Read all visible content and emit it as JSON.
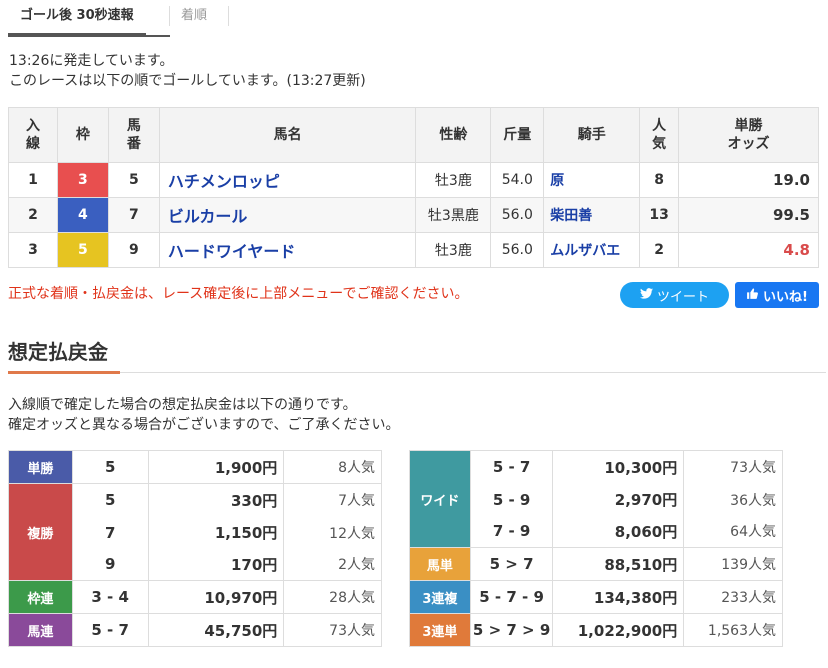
{
  "tabs": {
    "active": "ゴール後 30秒速報",
    "inactive": "着順"
  },
  "status": {
    "line1": "13:26に発走しています。",
    "line2": "このレースは以下の順でゴールしています。(13:27更新)"
  },
  "result_table": {
    "headers": {
      "rank": "入\n線",
      "waku": "枠",
      "umaban": "馬\n番",
      "name": "馬名",
      "sexage": "性齢",
      "weight": "斤量",
      "jockey": "騎手",
      "popularity": "人\n気",
      "odds": "単勝\nオッズ"
    },
    "rows": [
      {
        "rank": "1",
        "waku": "3",
        "waku_color": "#e84f4f",
        "umaban": "5",
        "name": "ハチメンロッピ",
        "sexage": "牡3鹿",
        "weight": "54.0",
        "jockey": "原",
        "popularity": "8",
        "odds": "19.0",
        "odds_color": "#333333"
      },
      {
        "rank": "2",
        "waku": "4",
        "waku_color": "#3a5fc0",
        "umaban": "7",
        "name": "ビルカール",
        "sexage": "牡3黒鹿",
        "weight": "56.0",
        "jockey": "柴田善",
        "popularity": "13",
        "odds": "99.5",
        "odds_color": "#333333"
      },
      {
        "rank": "3",
        "waku": "5",
        "waku_color": "#e6c421",
        "umaban": "9",
        "name": "ハードワイヤード",
        "sexage": "牡3鹿",
        "weight": "56.0",
        "jockey": "ムルザバエ",
        "popularity": "2",
        "odds": "4.8",
        "odds_color": "#d94b4b"
      }
    ]
  },
  "notice": "正式な着順・払戻金は、レース確定後に上部メニューでご確認ください。",
  "share": {
    "tweet": "ツイート",
    "like": "いいね!"
  },
  "section_title": "想定払戻金",
  "desc": {
    "line1": "入線順で確定した場合の想定払戻金は以下の通りです。",
    "line2": "確定オッズと異なる場合がございますので、ご了承ください。"
  },
  "payout_left": [
    {
      "type": "単勝",
      "color": "#4a5ba8",
      "rows": [
        {
          "combo": "5",
          "amount": "1,900円",
          "pop": "8人気"
        }
      ]
    },
    {
      "type": "複勝",
      "color": "#c94a4a",
      "rows": [
        {
          "combo": "5",
          "amount": "330円",
          "pop": "7人気"
        },
        {
          "combo": "7",
          "amount": "1,150円",
          "pop": "12人気"
        },
        {
          "combo": "9",
          "amount": "170円",
          "pop": "2人気"
        }
      ]
    },
    {
      "type": "枠連",
      "color": "#3c9a4a",
      "rows": [
        {
          "combo": "3 - 4",
          "amount": "10,970円",
          "pop": "28人気"
        }
      ]
    },
    {
      "type": "馬連",
      "color": "#8a4a9a",
      "rows": [
        {
          "combo": "5 - 7",
          "amount": "45,750円",
          "pop": "73人気"
        }
      ]
    }
  ],
  "payout_right": [
    {
      "type": "ワイド",
      "color": "#3f9aa0",
      "rows": [
        {
          "combo": "5 - 7",
          "amount": "10,300円",
          "pop": "73人気"
        },
        {
          "combo": "5 - 9",
          "amount": "2,970円",
          "pop": "36人気"
        },
        {
          "combo": "7 - 9",
          "amount": "8,060円",
          "pop": "64人気"
        }
      ]
    },
    {
      "type": "馬単",
      "color": "#e8a23a",
      "rows": [
        {
          "combo": "5 > 7",
          "amount": "88,510円",
          "pop": "139人気"
        }
      ]
    },
    {
      "type": "3連複",
      "color": "#3a8fc4",
      "rows": [
        {
          "combo": "5 - 7 - 9",
          "amount": "134,380円",
          "pop": "233人気"
        }
      ]
    },
    {
      "type": "3連単",
      "color": "#e07a3a",
      "rows": [
        {
          "combo": "5 > 7 > 9",
          "amount": "1,022,900円",
          "pop": "1,563人気"
        }
      ]
    }
  ]
}
